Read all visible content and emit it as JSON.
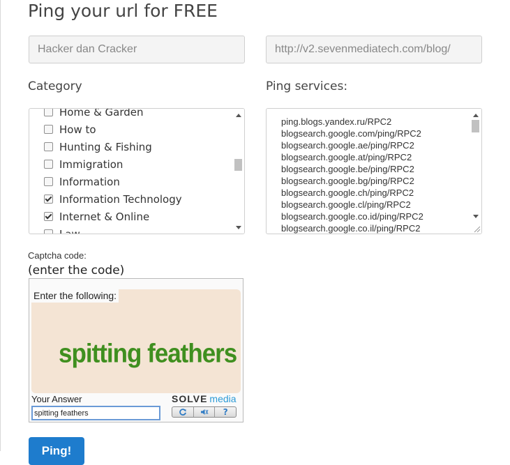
{
  "page": {
    "title": "Ping your url for FREE"
  },
  "form": {
    "blog_name": {
      "value": "Hacker dan Cracker"
    },
    "blog_url": {
      "value": "http://v2.sevenmediatech.com/blog/"
    }
  },
  "category": {
    "label": "Category",
    "items": [
      {
        "label": "Home & Garden",
        "checked": false
      },
      {
        "label": "How to",
        "checked": false
      },
      {
        "label": "Hunting & Fishing",
        "checked": false
      },
      {
        "label": "Immigration",
        "checked": false
      },
      {
        "label": "Information",
        "checked": false
      },
      {
        "label": "Information Technology",
        "checked": true
      },
      {
        "label": "Internet & Online",
        "checked": true
      },
      {
        "label": "Law",
        "checked": false
      }
    ]
  },
  "ping_services": {
    "label": "Ping services:",
    "items": [
      "ping.blogs.yandex.ru/RPC2",
      "blogsearch.google.com/ping/RPC2",
      "blogsearch.google.ae/ping/RPC2",
      "blogsearch.google.at/ping/RPC2",
      "blogsearch.google.be/ping/RPC2",
      "blogsearch.google.bg/ping/RPC2",
      "blogsearch.google.ch/ping/RPC2",
      "blogsearch.google.cl/ping/RPC2",
      "blogsearch.google.co.id/ping/RPC2",
      "blogsearch.google.co.il/ping/RPC2"
    ]
  },
  "captcha": {
    "label": "Captcha code:",
    "hint": "(enter the code)",
    "instruction": "Enter the following:",
    "challenge_text": "spitting feathers",
    "answer_label": "Your Answer",
    "answer_value": "spitting feathers",
    "brand_part1": "SOLVE",
    "brand_part2": "media",
    "controls": [
      {
        "name": "refresh-icon",
        "glyph": "⟳"
      },
      {
        "name": "audio-icon",
        "glyph": "🔈"
      },
      {
        "name": "help-icon",
        "glyph": "?"
      }
    ]
  },
  "submit": {
    "label": "Ping!"
  },
  "colors": {
    "accent": "#1e7ccd",
    "captcha_text": "#3f8f1f",
    "captcha_panel": "#f4e4d4"
  }
}
